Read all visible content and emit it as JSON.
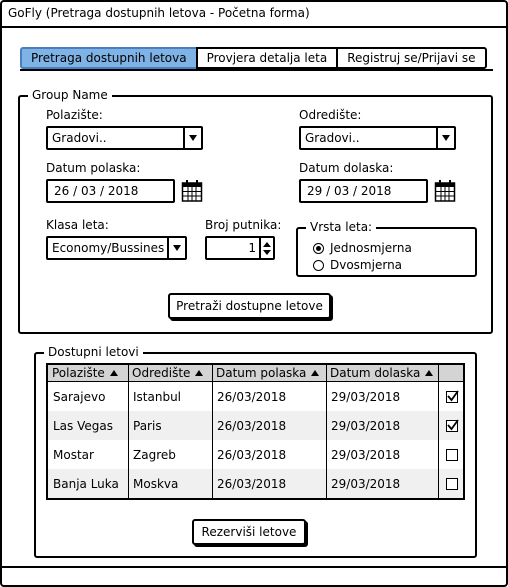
{
  "window": {
    "title": "GoFly (Pretraga dostupnih letova - Početna forma)"
  },
  "tabs": [
    {
      "label": "Pretraga dostupnih letova",
      "active": true
    },
    {
      "label": "Provjera detalja leta",
      "active": false
    },
    {
      "label": "Registruj se/Prijavi se",
      "active": false
    }
  ],
  "search": {
    "group_label": "Group Name",
    "origin_label": "Polazište:",
    "origin_value": "Gradovi..",
    "destination_label": "Odredište:",
    "destination_value": "Gradovi..",
    "departure_label": "Datum polaska:",
    "departure_value": "26 / 03 / 2018",
    "arrival_label": "Datum dolaska:",
    "arrival_value": "29 / 03 / 2018",
    "class_label": "Klasa leta:",
    "class_value": "Economy/Bussines",
    "passengers_label": "Broj putnika:",
    "passengers_value": "1",
    "flight_type_label": "Vrsta leta:",
    "flight_type_options": [
      {
        "label": "Jednosmjerna",
        "selected": true
      },
      {
        "label": "Dvosmjerna",
        "selected": false
      }
    ],
    "search_button": "Pretraži dostupne letove"
  },
  "flights": {
    "group_label": "Dostupni letovi",
    "columns": [
      "Polazište",
      "Odredište",
      "Datum polaska",
      "Datum dolaska"
    ],
    "rows": [
      {
        "from": "Sarajevo",
        "to": "Istanbul",
        "departure": "26/03/2018",
        "arrival": "29/03/2018",
        "checked": true
      },
      {
        "from": "Las Vegas",
        "to": "Paris",
        "departure": "26/03/2018",
        "arrival": "29/03/2018",
        "checked": true
      },
      {
        "from": "Mostar",
        "to": "Zagreb",
        "departure": "26/03/2018",
        "arrival": "29/03/2018",
        "checked": false
      },
      {
        "from": "Banja Luka",
        "to": "Moskva",
        "departure": "26/03/2018",
        "arrival": "29/03/2018",
        "checked": false
      }
    ],
    "reserve_button": "Rezerviši letove"
  },
  "colors": {
    "active_tab": "#7fb3e6",
    "table_header": "#d4d4d4"
  },
  "icons": [
    "calendar-icon",
    "chevron-down-icon",
    "sort-up-icon",
    "checkmark-icon"
  ]
}
